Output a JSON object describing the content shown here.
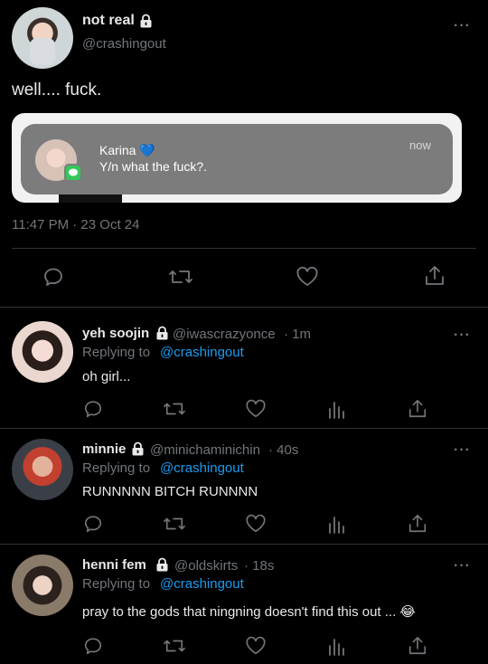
{
  "main_tweet": {
    "display_name": "not real",
    "handle": "@crashingout",
    "text": "well.... fuck.",
    "timestamp": "11:47 PM · 23 Oct 24",
    "notification": {
      "sender": "Karina 💙",
      "message": "Y/n what the fuck?.",
      "time": "now",
      "app_icon": "messages-app-icon"
    }
  },
  "replies": [
    {
      "display_name": "yeh soojin",
      "handle": "@iwascrazyonce",
      "time": "· 1m",
      "replying_label": "Replying to",
      "replying_to": "@crashingout",
      "text": "oh girl..."
    },
    {
      "display_name": "minnie",
      "handle": "@minichaminichin",
      "time": "· 40s",
      "replying_label": "Replying to",
      "replying_to": "@crashingout",
      "text": "RUNNNNN BITCH RUNNNN"
    },
    {
      "display_name": "henni fem",
      "handle": "@oldskirts",
      "time": "· 18s",
      "replying_label": "Replying to",
      "replying_to": "@crashingout",
      "text": "pray to the gods that ningning doesn't find this out ... 😂"
    }
  ],
  "colors": {
    "background": "#000000",
    "text": "#e7e9ea",
    "muted": "#71767b",
    "link": "#1d9bf0",
    "divider": "#2f3336"
  }
}
